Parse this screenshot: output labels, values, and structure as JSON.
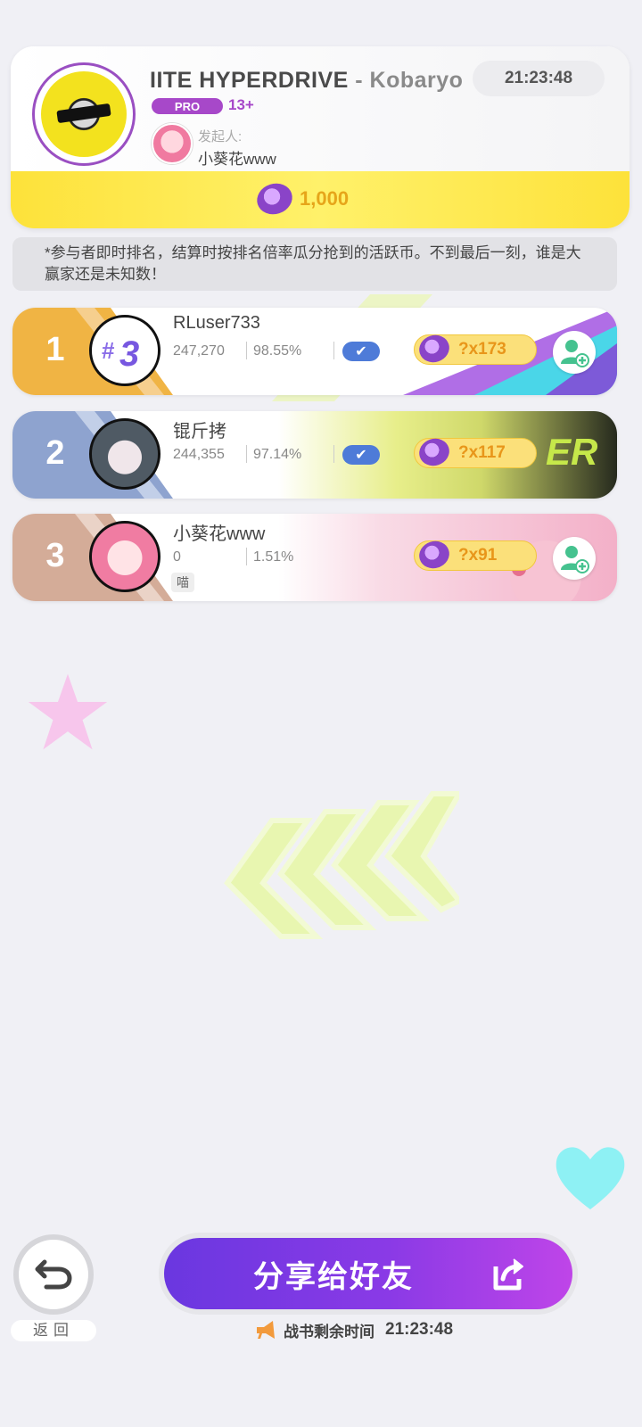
{
  "challenge": {
    "song_name": "IITE HYPERDRIVE",
    "artist": " - Kobaryo",
    "timer": "21:23:48",
    "difficulty": "PRO",
    "level": "13+",
    "initiator_label": "发起人:",
    "initiator_name": "小葵花www",
    "reward": "1,000"
  },
  "notice": "*参与者即时排名，结算时按排名倍率瓜分抢到的活跃币。不到最后一刻，谁是大赢家还是未知数！",
  "ranking": [
    {
      "rank": "1",
      "name": "RLuser733",
      "score": "247,270",
      "accuracy": "98.55%",
      "multiplier": "?x173",
      "color": "#f0b444"
    },
    {
      "rank": "2",
      "name": "锟斤拷",
      "score": "244,355",
      "accuracy": "97.14%",
      "multiplier": "?x117",
      "color": "#8ea3cf"
    },
    {
      "rank": "3",
      "name": "小葵花www",
      "score": "0",
      "accuracy": "1.51%",
      "multiplier": "?x91",
      "tag": "喵",
      "color": "#d4ac98"
    }
  ],
  "footer": {
    "back_label": "返回",
    "share_label": "分享给好友",
    "remaining_label": "战书剩余时间",
    "remaining_time": "21:23:48"
  }
}
